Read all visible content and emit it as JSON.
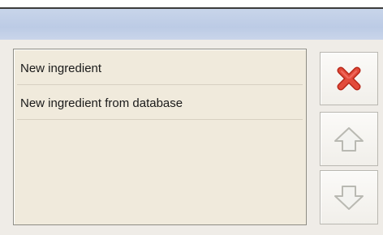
{
  "window": {
    "title": ""
  },
  "list": {
    "items": [
      {
        "label": "New ingredient"
      },
      {
        "label": "New ingredient from database"
      }
    ]
  },
  "side_buttons": {
    "delete": {
      "icon": "red-x-icon",
      "color": "#d83b2a"
    },
    "move_up": {
      "icon": "arrow-up-icon"
    },
    "move_down": {
      "icon": "arrow-down-icon"
    }
  }
}
